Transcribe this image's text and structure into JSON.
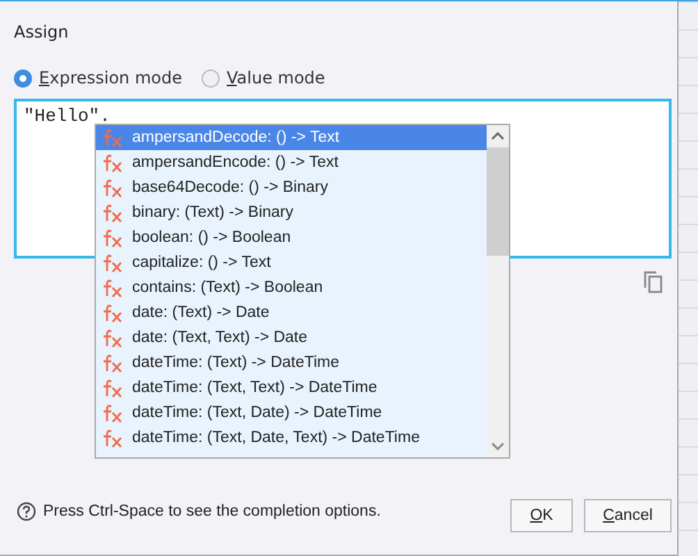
{
  "dialog": {
    "title": "Assign"
  },
  "modes": [
    {
      "label": "Expression mode",
      "selected": true
    },
    {
      "label": "Value mode",
      "selected": false
    }
  ],
  "editor": {
    "value": "\"Hello\"."
  },
  "completions": [
    {
      "label": "ampersandDecode: () -> Text",
      "selected": true
    },
    {
      "label": "ampersandEncode: () -> Text",
      "selected": false
    },
    {
      "label": "base64Decode: () -> Binary",
      "selected": false
    },
    {
      "label": "binary: (Text) -> Binary",
      "selected": false
    },
    {
      "label": "boolean: () -> Boolean",
      "selected": false
    },
    {
      "label": "capitalize: () -> Text",
      "selected": false
    },
    {
      "label": "contains: (Text) -> Boolean",
      "selected": false
    },
    {
      "label": "date: (Text) -> Date",
      "selected": false
    },
    {
      "label": "date: (Text, Text) -> Date",
      "selected": false
    },
    {
      "label": "dateTime: (Text) -> DateTime",
      "selected": false
    },
    {
      "label": "dateTime: (Text, Text) -> DateTime",
      "selected": false
    },
    {
      "label": "dateTime: (Text, Date) -> DateTime",
      "selected": false
    },
    {
      "label": "dateTime: (Text, Date, Text) -> DateTime",
      "selected": false
    }
  ],
  "hint": "Press Ctrl-Space to see the completion options.",
  "buttons": [
    "OK",
    "Cancel"
  ]
}
